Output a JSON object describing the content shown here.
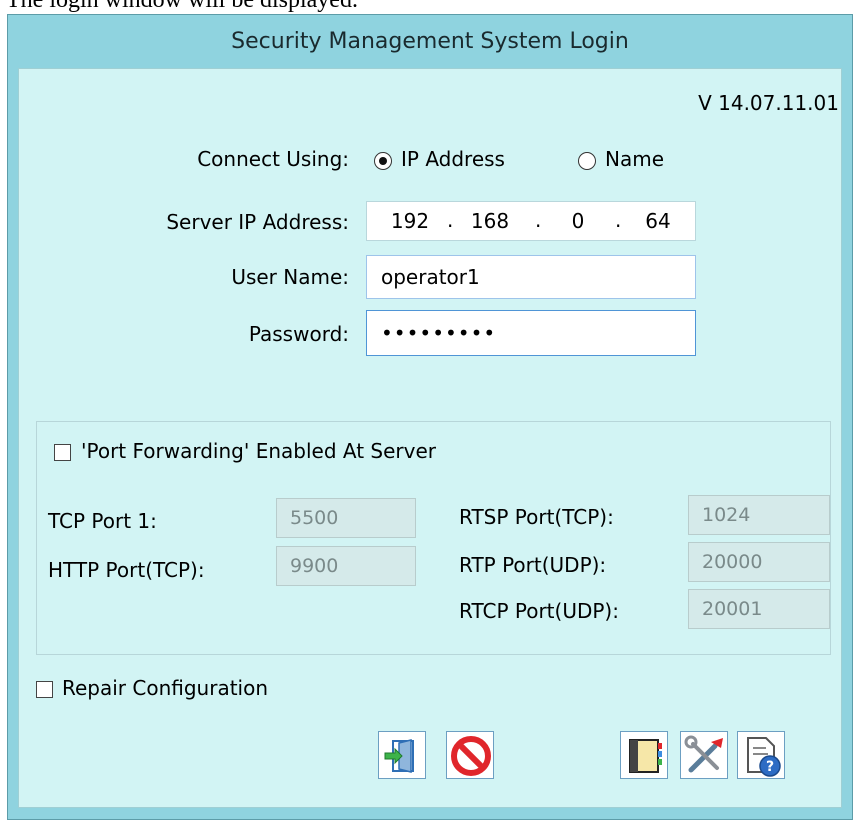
{
  "caption_fragment": "The login window will be displayed.",
  "window": {
    "title": "Security Management System Login"
  },
  "version": "V 14.07.11.01",
  "connect": {
    "label": "Connect Using:",
    "options": [
      "IP Address",
      "Name"
    ],
    "selected": "IP Address"
  },
  "server_ip": {
    "label": "Server IP Address:",
    "octets": [
      "192",
      "168",
      "0",
      "64"
    ],
    "separator": "."
  },
  "user_name": {
    "label": "User Name:",
    "value": "operator1"
  },
  "password": {
    "label": "Password:",
    "value": "•••••••••"
  },
  "port_forwarding": {
    "label": "'Port Forwarding' Enabled At Server",
    "checked": false,
    "tcp_port_1": {
      "label": "TCP Port 1:",
      "value": "5500"
    },
    "http_port": {
      "label": "HTTP Port(TCP):",
      "value": "9900"
    },
    "rtsp_port": {
      "label": "RTSP Port(TCP):",
      "value": "1024"
    },
    "rtp_port": {
      "label": "RTP Port(UDP):",
      "value": "20000"
    },
    "rtcp_port": {
      "label": "RTCP Port(UDP):",
      "value": "20001"
    }
  },
  "repair": {
    "label": "Repair Configuration",
    "checked": false
  },
  "toolbar": {
    "buttons": [
      "login-icon",
      "cancel-icon",
      "address-book-icon",
      "tools-icon",
      "help-document-icon"
    ]
  },
  "colors": {
    "window_frame": "#8fd3df",
    "client_bg": "#d2f4f4",
    "input_border_focus": "#4f95d6",
    "disabled_input_bg": "#d5eaea"
  }
}
